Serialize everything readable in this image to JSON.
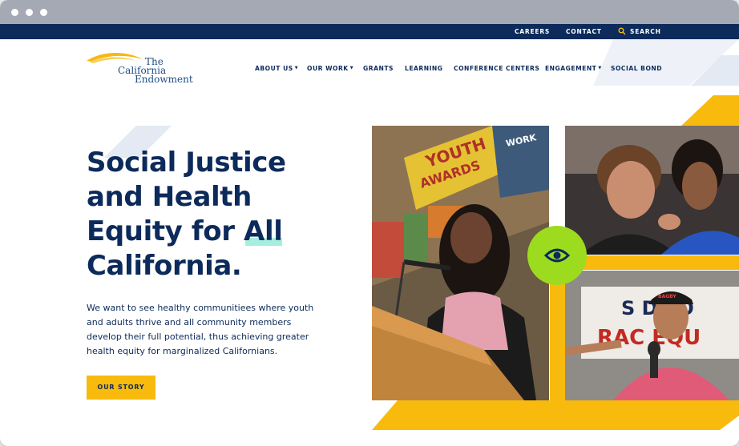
{
  "browser": {
    "dots": 3
  },
  "utility_nav": {
    "careers": "CAREERS",
    "contact": "CONTACT",
    "search": "SEARCH"
  },
  "logo": {
    "line1": "The",
    "line2": "California",
    "line3": "Endowment"
  },
  "main_nav": [
    {
      "label": "ABOUT US",
      "dropdown": true
    },
    {
      "label": "OUR WORK",
      "dropdown": true
    },
    {
      "label": "GRANTS",
      "dropdown": false
    },
    {
      "label": "LEARNING",
      "dropdown": false
    },
    {
      "label": "CONFERENCE CENTERS",
      "dropdown": false
    },
    {
      "label": "ENGAGEMENT",
      "dropdown": true
    },
    {
      "label": "SOCIAL BOND",
      "dropdown": false
    }
  ],
  "hero": {
    "headline_1": "Social Justice",
    "headline_2": "and Health",
    "headline_3a": "Equity for ",
    "headline_3b": "All",
    "headline_4": "California.",
    "intro": "We want to see healthy communitiees where youth and adults thrive and all community members develop their full potential, thus achieving greater health equity for marginalized Californians.",
    "cta": "OUR STORY"
  },
  "photos": {
    "sign_text_1": "YOUTH",
    "sign_text_2": "AWARDS",
    "sign_text_3": "WORK",
    "protest_sign_1": "S   D FO",
    "protest_sign_2": "RAC   EQU",
    "cap_text": "BAGBY"
  },
  "colors": {
    "navy": "#0c2a5a",
    "gold": "#f8ba0d",
    "lime": "#9ddb1e",
    "mint": "#a6efdf",
    "chrome": "#a5a9b3"
  },
  "icons": {
    "search": "search-icon",
    "eye": "eye-icon",
    "caret": "caret-down-icon"
  }
}
